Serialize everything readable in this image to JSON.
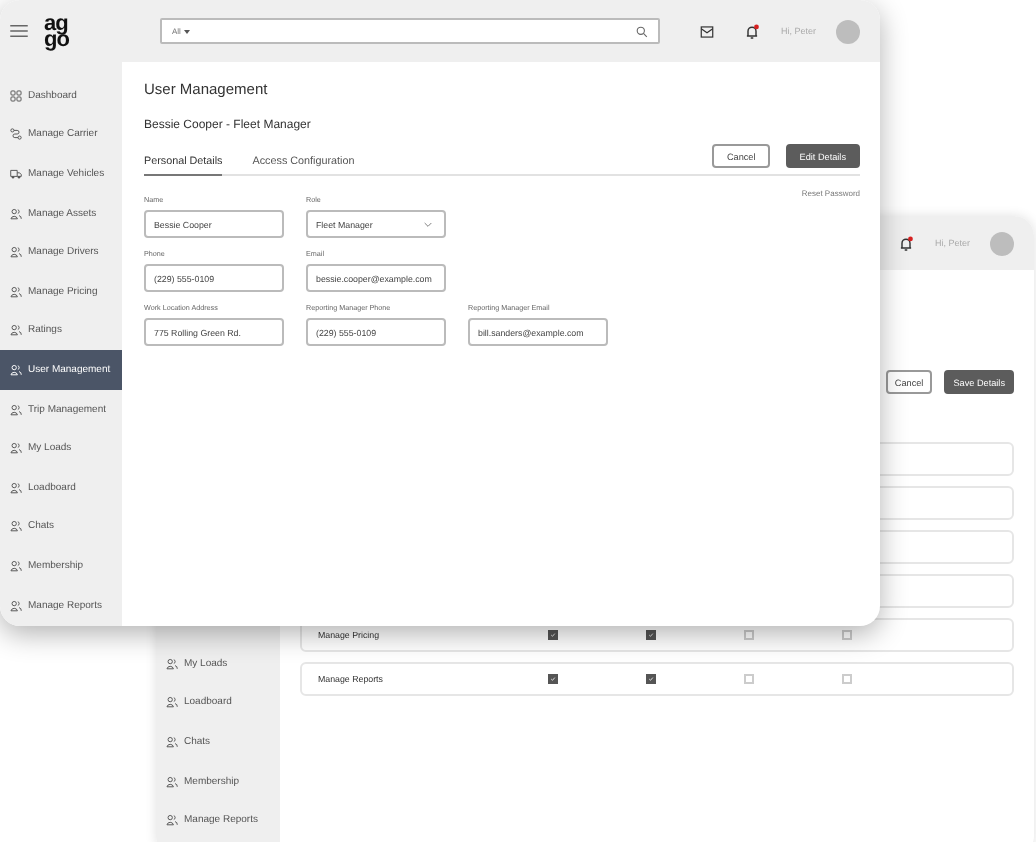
{
  "back_window": {
    "header": {
      "has_alert": true,
      "greeting": "Hi, Peter"
    },
    "sidebar_items": [
      {
        "label": "My Loads"
      },
      {
        "label": "Loadboard"
      },
      {
        "label": "Chats"
      },
      {
        "label": "Membership"
      },
      {
        "label": "Manage Reports"
      }
    ],
    "buttons": [
      {
        "label": "Cancel",
        "kind": "secondary"
      },
      {
        "label": "Save Details",
        "kind": "primary"
      }
    ],
    "permission_rows": [
      {},
      {},
      {},
      {},
      {
        "label": "Manage Pricing",
        "checks": [
          {
            "checked": true
          },
          {
            "checked": true
          },
          {
            "checked": false
          },
          {
            "checked": false
          }
        ]
      },
      {
        "label": "Manage Reports",
        "checks": [
          {
            "checked": true
          },
          {
            "checked": true
          },
          {
            "checked": false
          },
          {
            "checked": false
          }
        ]
      }
    ]
  },
  "front_window": {
    "header": {
      "logo": [
        "ag",
        "go"
      ],
      "search_filter": "All",
      "has_alert": true,
      "greeting": "Hi, Peter"
    },
    "sidebar_items": [
      {
        "label": "Dashboard",
        "selected": false
      },
      {
        "label": "Manage Carrier",
        "selected": false
      },
      {
        "label": "Manage Vehicles",
        "selected": false
      },
      {
        "label": "Manage Assets",
        "selected": false
      },
      {
        "label": "Manage Drivers",
        "selected": false
      },
      {
        "label": "Manage Pricing",
        "selected": false
      },
      {
        "label": "Ratings",
        "selected": false
      },
      {
        "label": "User Management",
        "selected": true
      },
      {
        "label": "Trip Management",
        "selected": false
      },
      {
        "label": "My Loads",
        "selected": false
      },
      {
        "label": "Loadboard",
        "selected": false
      },
      {
        "label": "Chats",
        "selected": false
      },
      {
        "label": "Membership",
        "selected": false
      },
      {
        "label": "Manage Reports",
        "selected": false
      }
    ],
    "page_title": "User Management",
    "subtitle": "Bessie Cooper - Fleet Manager",
    "tabs": [
      {
        "label": "Personal Details",
        "selected": true
      },
      {
        "label": "Access Configuration",
        "selected": false
      }
    ],
    "buttons": [
      {
        "label": "Cancel",
        "kind": "secondary"
      },
      {
        "label": "Edit Details",
        "kind": "primary"
      }
    ],
    "reset_link": "Reset Password",
    "field_rows": [
      [
        {
          "label": "Name",
          "value": "Bessie Cooper",
          "kind": "text"
        },
        {
          "label": "Role",
          "value": "Fleet Manager",
          "kind": "select"
        }
      ],
      [
        {
          "label": "Phone",
          "value": "(229) 555-0109",
          "kind": "text"
        },
        {
          "label": "Email",
          "value": "bessie.cooper@example.com",
          "kind": "text"
        }
      ],
      [
        {
          "label": "Work Location Address",
          "value": "775 Rolling Green Rd.",
          "kind": "text"
        },
        {
          "label": "Reporting Manager Phone",
          "value": "(229) 555-0109",
          "kind": "text"
        },
        {
          "label": "Reporting Manager Email",
          "value": "bill.sanders@example.com",
          "kind": "text"
        }
      ]
    ]
  }
}
